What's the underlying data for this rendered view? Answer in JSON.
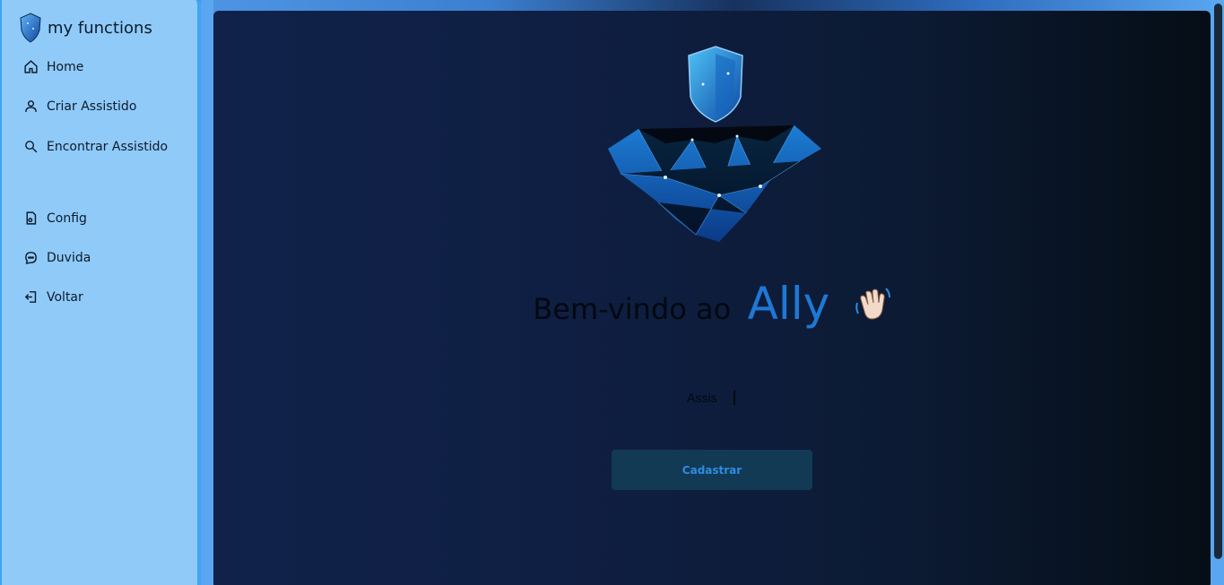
{
  "sidebar": {
    "brand": {
      "title": "my functions",
      "logo_icon": "shield-logo-icon"
    },
    "items": [
      {
        "label": "Home",
        "icon": "home-icon"
      },
      {
        "label": "Criar Assistido",
        "icon": "user-icon"
      },
      {
        "label": "Encontrar Assistido",
        "icon": "search-icon"
      },
      {
        "label": "Config",
        "icon": "config-icon"
      },
      {
        "label": "Duvida",
        "icon": "chat-icon"
      },
      {
        "label": "Voltar",
        "icon": "logout-icon"
      }
    ]
  },
  "main": {
    "welcome_text": "Bem-vindo ao",
    "brand_name": "Ally",
    "typed_text": "Assis",
    "cta_label": "Cadastrar"
  },
  "colors": {
    "sidebar_bg": "#90caf9",
    "accent": "#1e78d6",
    "button_bg": "#123a55",
    "button_text": "#2d8ce0"
  }
}
